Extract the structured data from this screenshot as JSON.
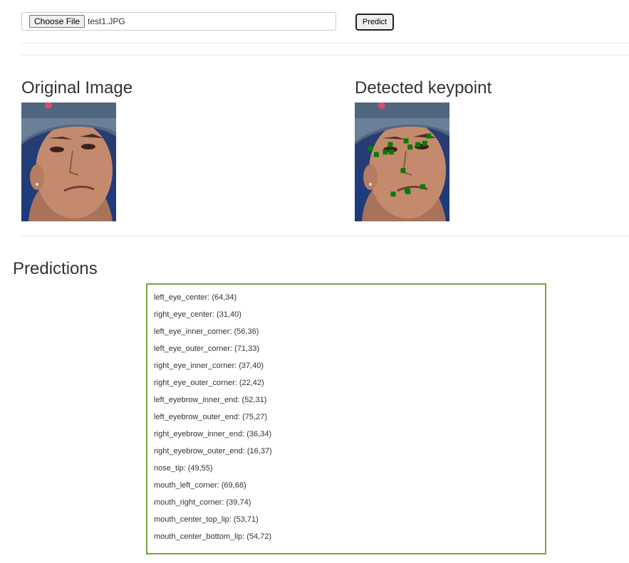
{
  "upload": {
    "choose_label": "Choose File",
    "file_name": "test1.JPG",
    "predict_label": "Predict"
  },
  "headings": {
    "original": "Original Image",
    "detected": "Detected keypoint",
    "predictions": "Predictions"
  },
  "predictions": [
    {
      "name": "left_eye_center",
      "x": 64,
      "y": 34
    },
    {
      "name": "right_eye_center",
      "x": 31,
      "y": 40
    },
    {
      "name": "left_eye_inner_corner",
      "x": 56,
      "y": 36
    },
    {
      "name": "left_eye_outer_corner",
      "x": 71,
      "y": 33
    },
    {
      "name": "right_eye_inner_corner",
      "x": 37,
      "y": 40
    },
    {
      "name": "right_eye_outer_corner",
      "x": 22,
      "y": 42
    },
    {
      "name": "left_eyebrow_inner_end",
      "x": 52,
      "y": 31
    },
    {
      "name": "left_eyebrow_outer_end",
      "x": 75,
      "y": 27
    },
    {
      "name": "right_eyebrow_inner_end",
      "x": 36,
      "y": 34
    },
    {
      "name": "right_eyebrow_outer_end",
      "x": 16,
      "y": 37
    },
    {
      "name": "nose_tip",
      "x": 49,
      "y": 55
    },
    {
      "name": "mouth_left_corner",
      "x": 69,
      "y": 68
    },
    {
      "name": "mouth_right_corner",
      "x": 39,
      "y": 74
    },
    {
      "name": "mouth_center_top_lip",
      "x": 53,
      "y": 71
    },
    {
      "name": "mouth_center_bottom_lip",
      "x": 54,
      "y": 72
    }
  ],
  "colors": {
    "keypoint": "#0a7a0a",
    "prediction_border": "#74a83a"
  }
}
